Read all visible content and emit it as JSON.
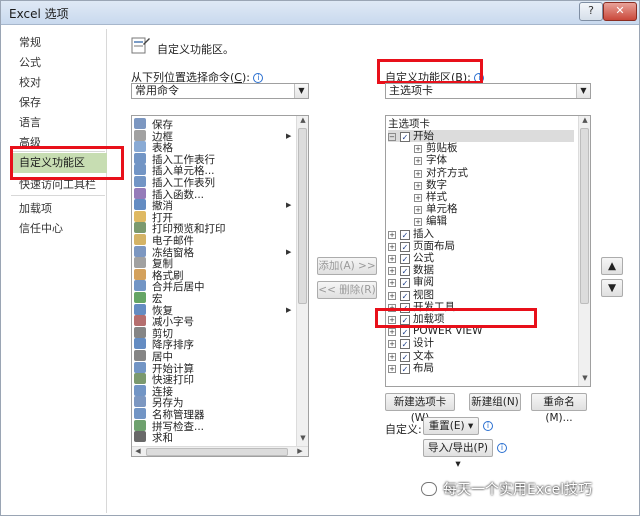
{
  "window": {
    "title": "Excel 选项",
    "help_label": "?",
    "close_label": "✕"
  },
  "nav": {
    "items": [
      {
        "label": "常规",
        "selected": false
      },
      {
        "label": "公式",
        "selected": false
      },
      {
        "label": "校对",
        "selected": false
      },
      {
        "label": "保存",
        "selected": false
      },
      {
        "label": "语言",
        "selected": false
      },
      {
        "label": "高级",
        "selected": false
      },
      {
        "label": "自定义功能区",
        "selected": true
      },
      {
        "label": "快速访问工具栏",
        "selected": false
      },
      {
        "label": "加载项",
        "selected": false
      },
      {
        "label": "信任中心",
        "selected": false
      }
    ]
  },
  "header": {
    "title": "自定义功能区。"
  },
  "commands_from": {
    "label_prefix": "从下列位置选择命令(",
    "label_key": "C",
    "label_suffix": "):",
    "info_icon": "info-icon",
    "value": "常用命令"
  },
  "customize_ribbon": {
    "label_prefix": "自定义功能区(",
    "label_key": "B",
    "label_suffix": "):",
    "value": "主选项卡"
  },
  "command_list": [
    {
      "label": "保存",
      "icon": "save-icon"
    },
    {
      "label": "边框",
      "icon": "border-icon",
      "submenu": true
    },
    {
      "label": "表格",
      "icon": "table-icon"
    },
    {
      "label": "插入工作表行",
      "icon": "insert-rows-icon"
    },
    {
      "label": "插入单元格...",
      "icon": "insert-cells-icon"
    },
    {
      "label": "插入工作表列",
      "icon": "insert-columns-icon"
    },
    {
      "label": "插入函数...",
      "icon": "function-icon"
    },
    {
      "label": "撤消",
      "icon": "undo-icon",
      "submenu": true
    },
    {
      "label": "打开",
      "icon": "open-folder-icon"
    },
    {
      "label": "打印预览和打印",
      "icon": "print-preview-icon"
    },
    {
      "label": "电子邮件",
      "icon": "email-icon"
    },
    {
      "label": "冻结窗格",
      "icon": "freeze-panes-icon",
      "submenu": true
    },
    {
      "label": "复制",
      "icon": "copy-icon"
    },
    {
      "label": "格式刷",
      "icon": "format-painter-icon"
    },
    {
      "label": "合并后居中",
      "icon": "merge-center-icon"
    },
    {
      "label": "宏",
      "icon": "macro-icon"
    },
    {
      "label": "恢复",
      "icon": "redo-icon",
      "submenu": true
    },
    {
      "label": "减小字号",
      "icon": "font-decrease-icon"
    },
    {
      "label": "剪切",
      "icon": "cut-icon"
    },
    {
      "label": "降序排序",
      "icon": "sort-desc-icon"
    },
    {
      "label": "居中",
      "icon": "align-center-icon"
    },
    {
      "label": "开始计算",
      "icon": "calculate-icon"
    },
    {
      "label": "快速打印",
      "icon": "quick-print-icon"
    },
    {
      "label": "连接",
      "icon": "connections-icon"
    },
    {
      "label": "另存为",
      "icon": "save-as-icon"
    },
    {
      "label": "名称管理器",
      "icon": "name-manager-icon"
    },
    {
      "label": "拼写检查...",
      "icon": "spelling-icon"
    },
    {
      "label": "求和",
      "icon": "sum-icon"
    }
  ],
  "buttons": {
    "add": "添加(A) >>",
    "remove": "<< 删除(R)",
    "new_tab": "新建选项卡(W)",
    "new_group": "新建组(N)",
    "rename": "重命名(M)...",
    "reset": "重置(E) ▾",
    "import_export": "导入/导出(P) ▾",
    "move_up": "▲",
    "move_down": "▼"
  },
  "customizations_label": "自定义:",
  "tree": {
    "root": "主选项卡",
    "items": [
      {
        "label": "开始",
        "level": 0,
        "expander": "⊟",
        "checked": true,
        "selected": true
      },
      {
        "label": "剪贴板",
        "level": 1,
        "expander": "⊞"
      },
      {
        "label": "字体",
        "level": 1,
        "expander": "⊞"
      },
      {
        "label": "对齐方式",
        "level": 1,
        "expander": "⊞"
      },
      {
        "label": "数字",
        "level": 1,
        "expander": "⊞"
      },
      {
        "label": "样式",
        "level": 1,
        "expander": "⊞"
      },
      {
        "label": "单元格",
        "level": 1,
        "expander": "⊞"
      },
      {
        "label": "编辑",
        "level": 1,
        "expander": "⊞"
      },
      {
        "label": "插入",
        "level": 0,
        "expander": "⊞",
        "checked": true
      },
      {
        "label": "页面布局",
        "level": 0,
        "expander": "⊞",
        "checked": true
      },
      {
        "label": "公式",
        "level": 0,
        "expander": "⊞",
        "checked": true
      },
      {
        "label": "数据",
        "level": 0,
        "expander": "⊞",
        "checked": true
      },
      {
        "label": "审阅",
        "level": 0,
        "expander": "⊞",
        "checked": true
      },
      {
        "label": "视图",
        "level": 0,
        "expander": "⊞",
        "checked": true
      },
      {
        "label": "开发工具",
        "level": 0,
        "expander": "⊞",
        "checked": true
      },
      {
        "label": "加载项",
        "level": 0,
        "expander": "⊞",
        "checked": true
      },
      {
        "label": "POWER VIEW",
        "level": 0,
        "expander": "⊞",
        "checked": true
      },
      {
        "label": "设计",
        "level": 0,
        "expander": "⊞",
        "checked": true
      },
      {
        "label": "文本",
        "level": 0,
        "expander": "⊞",
        "checked": true
      },
      {
        "label": "布局",
        "level": 0,
        "expander": "⊞",
        "checked": true
      }
    ]
  },
  "watermark": {
    "text": "每天一个实用Excel技巧"
  },
  "colors": {
    "highlight": "#e8101a",
    "nav_selected": "#c7ddb2"
  }
}
